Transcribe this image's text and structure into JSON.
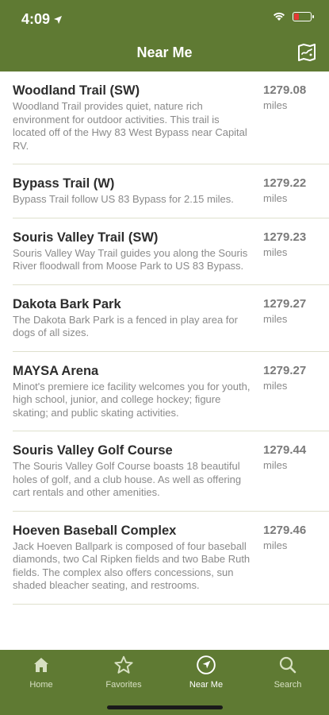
{
  "status": {
    "time": "4:09"
  },
  "header": {
    "title": "Near Me"
  },
  "items": [
    {
      "title": "Woodland Trail (SW)",
      "desc": "Woodland Trail provides quiet, nature rich environment for outdoor activities. This trail is located off of the Hwy 83 West Bypass near Capital RV.",
      "dist": "1279.08",
      "unit": "miles"
    },
    {
      "title": "Bypass Trail (W)",
      "desc": "Bypass Trail follow US 83 Bypass for 2.15 miles.",
      "dist": "1279.22",
      "unit": "miles"
    },
    {
      "title": "Souris Valley Trail (SW)",
      "desc": "Souris Valley Way Trail guides you along the Souris River floodwall from Moose Park to US 83 Bypass.",
      "dist": "1279.23",
      "unit": "miles"
    },
    {
      "title": "Dakota Bark Park",
      "desc": "The Dakota Bark Park is a fenced in play area for dogs of all sizes.",
      "dist": "1279.27",
      "unit": "miles"
    },
    {
      "title": "MAYSA Arena",
      "desc": "Minot's premiere ice facility welcomes you for youth, high school, junior, and college hockey; figure skating; and public skating activities.",
      "dist": "1279.27",
      "unit": "miles"
    },
    {
      "title": "Souris Valley Golf Course",
      "desc": "The Souris Valley Golf Course boasts 18 beautiful holes of golf, and a club house. As well as offering cart rentals and other amenities.",
      "dist": "1279.44",
      "unit": "miles"
    },
    {
      "title": "Hoeven Baseball Complex",
      "desc": "Jack Hoeven Ballpark is composed of four baseball diamonds, two Cal Ripken fields and two Babe Ruth fields. The complex also offers concessions, sun shaded bleacher seating, and restrooms.",
      "dist": "1279.46",
      "unit": "miles"
    }
  ],
  "tabs": [
    {
      "label": "Home",
      "icon": "home-icon"
    },
    {
      "label": "Favorites",
      "icon": "star-icon"
    },
    {
      "label": "Near Me",
      "icon": "compass-icon"
    },
    {
      "label": "Search",
      "icon": "search-icon"
    }
  ],
  "colors": {
    "brand": "#5f7a33",
    "battery_low": "#e53935"
  }
}
